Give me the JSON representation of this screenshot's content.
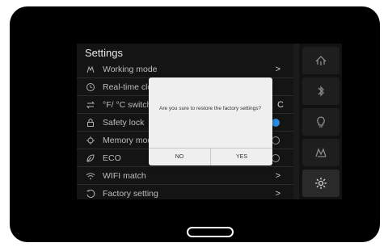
{
  "settings": {
    "title": "Settings",
    "items": [
      {
        "label": "Working mode",
        "icon": "working-mode-icon",
        "right": ">"
      },
      {
        "label": "Real-time clo",
        "icon": "clock-icon",
        "right": ""
      },
      {
        "label": "°F/ °C switch",
        "icon": "unit-switch-icon",
        "right": "C"
      },
      {
        "label": "Safety lock",
        "icon": "lock-icon",
        "right": ""
      },
      {
        "label": "Memory mod",
        "icon": "memory-icon",
        "right": ""
      },
      {
        "label": "ECO",
        "icon": "leaf-icon",
        "right": ""
      },
      {
        "label": "WIFI match",
        "icon": "wifi-icon",
        "right": ">"
      },
      {
        "label": "Factory setting",
        "icon": "factory-reset-icon",
        "right": ">"
      }
    ]
  },
  "sidebar": {
    "buttons": [
      {
        "icon": "shower-icon"
      },
      {
        "icon": "bluetooth-icon"
      },
      {
        "icon": "bulb-icon"
      },
      {
        "icon": "mode-icon"
      },
      {
        "icon": "gear-icon",
        "active": true
      }
    ]
  },
  "dialog": {
    "message": "Are you sure to restore the factory settings?",
    "no_label": "NO",
    "yes_label": "YES"
  },
  "colors": {
    "accent": "#2b8ce0",
    "background": "#000000",
    "dialog": "#efefef"
  }
}
